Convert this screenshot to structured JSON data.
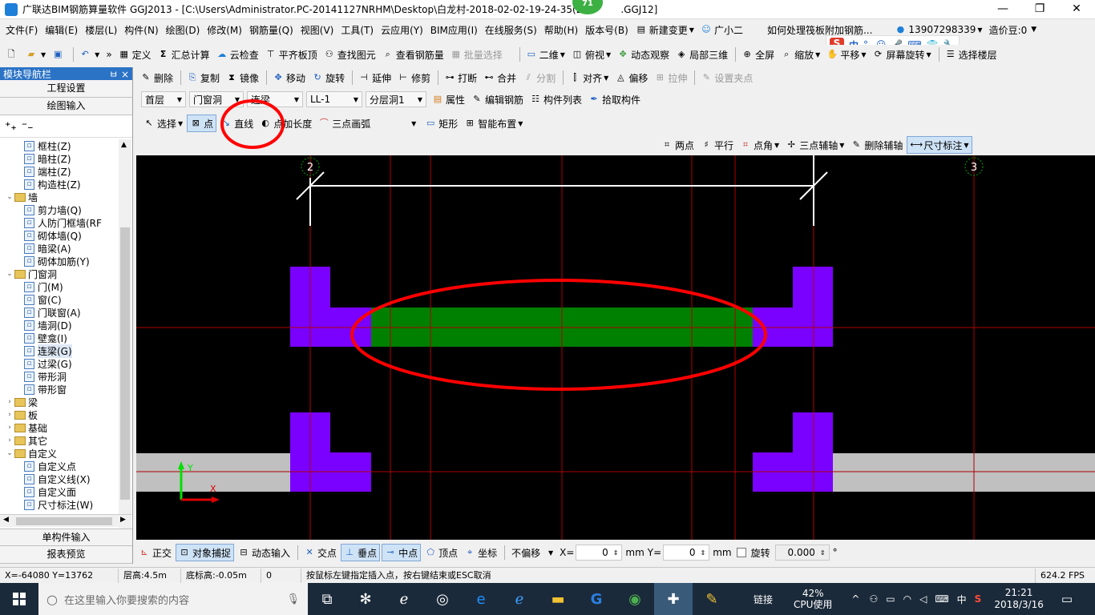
{
  "window": {
    "title": "广联达BIM钢筋算量软件 GGJ2013 - [C:\\Users\\Administrator.PC-20141127NRHM\\Desktop\\白龙村-2018-02-02-19-24-35(2",
    "title_tail": ".GGJ12]",
    "badge": "71",
    "minimize": "—",
    "restore": "❐",
    "close": "✕"
  },
  "menu": {
    "items": [
      "文件(F)",
      "编辑(E)",
      "楼层(L)",
      "构件(N)",
      "绘图(D)",
      "修改(M)",
      "钢筋量(Q)",
      "视图(V)",
      "工具(T)",
      "云应用(Y)",
      "BIM应用(I)",
      "在线服务(S)",
      "帮助(H)",
      "版本号(B)"
    ],
    "new_change": "新建变更",
    "assistant": "广小二",
    "question": "如何处理筏板附加钢筋...",
    "phone": "13907298339",
    "beans": "造价豆:0"
  },
  "toolbar1": {
    "items": [
      "定义",
      "汇总计算",
      "云检查",
      "平齐板顶",
      "查找图元",
      "查看钢筋量",
      "批量选择",
      "二维",
      "俯视",
      "动态观察",
      "局部三维",
      "全屏",
      "缩放",
      "平移",
      "屏幕旋转",
      "选择楼层"
    ]
  },
  "toolbar2": {
    "items": [
      "删除",
      "复制",
      "镜像",
      "移动",
      "旋转",
      "延伸",
      "修剪",
      "打断",
      "合并",
      "分割",
      "对齐",
      "偏移",
      "拉伸",
      "设置夹点"
    ]
  },
  "toolbar3": {
    "floor": "首层",
    "category": "门窗洞",
    "type": "连梁",
    "component": "LL-1",
    "layer": "分层洞1",
    "items": [
      "属性",
      "编辑钢筋",
      "构件列表",
      "拾取构件"
    ]
  },
  "toolbar4": {
    "items": [
      "选择",
      "点",
      "直线",
      "点加长度",
      "三点画弧",
      "矩形",
      "智能布置"
    ]
  },
  "toolbar5": {
    "items": [
      "两点",
      "平行",
      "点角",
      "三点辅轴",
      "删除辅轴",
      "尺寸标注"
    ]
  },
  "leftpanel": {
    "header": "模块导航栏",
    "pin": "ㅂ",
    "close": "×",
    "btn_project": "工程设置",
    "btn_draw": "绘图输入",
    "btn_single": "单构件输入",
    "btn_report": "报表预览",
    "tree": [
      {
        "label": "框柱(Z)",
        "level": 2
      },
      {
        "label": "暗柱(Z)",
        "level": 2
      },
      {
        "label": "端柱(Z)",
        "level": 2
      },
      {
        "label": "构造柱(Z)",
        "level": 2
      },
      {
        "label": "墙",
        "level": 1,
        "folder": true,
        "open": true
      },
      {
        "label": "剪力墙(Q)",
        "level": 2
      },
      {
        "label": "人防门框墙(RF",
        "level": 2
      },
      {
        "label": "砌体墙(Q)",
        "level": 2
      },
      {
        "label": "暗梁(A)",
        "level": 2
      },
      {
        "label": "砌体加筋(Y)",
        "level": 2
      },
      {
        "label": "门窗洞",
        "level": 1,
        "folder": true,
        "open": true
      },
      {
        "label": "门(M)",
        "level": 2
      },
      {
        "label": "窗(C)",
        "level": 2
      },
      {
        "label": "门联窗(A)",
        "level": 2
      },
      {
        "label": "墙洞(D)",
        "level": 2
      },
      {
        "label": "壁龛(I)",
        "level": 2
      },
      {
        "label": "连梁(G)",
        "level": 2,
        "selected": true
      },
      {
        "label": "过梁(G)",
        "level": 2
      },
      {
        "label": "带形洞",
        "level": 2
      },
      {
        "label": "带形窗",
        "level": 2
      },
      {
        "label": "梁",
        "level": 1,
        "folder": true
      },
      {
        "label": "板",
        "level": 1,
        "folder": true
      },
      {
        "label": "基础",
        "level": 1,
        "folder": true
      },
      {
        "label": "其它",
        "level": 1,
        "folder": true
      },
      {
        "label": "自定义",
        "level": 1,
        "folder": true,
        "open": true
      },
      {
        "label": "自定义点",
        "level": 2
      },
      {
        "label": "自定义线(X)",
        "level": 2
      },
      {
        "label": "自定义面",
        "level": 2
      },
      {
        "label": "尺寸标注(W)",
        "level": 2
      }
    ]
  },
  "canvas": {
    "axis_left": "2",
    "axis_right": "3",
    "ucs_x": "X",
    "ucs_y": "Y"
  },
  "snapbar": {
    "items": [
      "正交",
      "对象捕捉",
      "动态输入",
      "交点",
      "垂点",
      "中点",
      "顶点",
      "坐标"
    ],
    "offset_mode": "不偏移",
    "x_label": "X=",
    "x_value": "0",
    "y_label": "Y=",
    "y_value": "0",
    "unit": "mm",
    "rotate_label": "旋转",
    "rotate_value": "0.000",
    "degree": "°"
  },
  "status": {
    "coords": "X=-64080 Y=13762",
    "floor_height": "层高:4.5m",
    "bottom_height": "底标高:-0.05m",
    "zero": "0",
    "hint": "按鼠标左键指定插入点，按右键结束或ESC取消",
    "fps": "624.2 FPS"
  },
  "taskbar": {
    "search_placeholder": "在这里输入你要搜索的内容",
    "link": "链接",
    "cpu_percent": "42%",
    "cpu_label": "CPU使用",
    "ime": "中",
    "time": "21:21",
    "date": "2018/3/16"
  },
  "colors": {
    "canvas_bg": "#000000",
    "column_purple": "#7a00ff",
    "beam_green": "#008000",
    "wall_gray": "#c0c0c0",
    "grid_red": "#b00000",
    "annotation_red": "#ff0000",
    "dimension_white": "#ffffff"
  }
}
